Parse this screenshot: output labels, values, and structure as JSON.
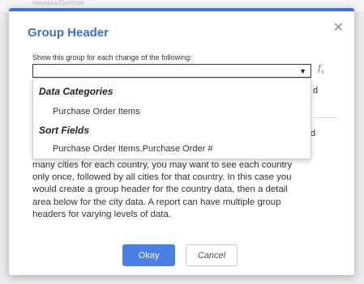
{
  "background": {
    "partial_text": "aaaaaaa/Durchaa"
  },
  "dialog": {
    "title": "Group Header",
    "close_icon": "close-icon",
    "field_label": "Show this group for each change of the following:",
    "select_value": "",
    "fx_label": "f",
    "fx_sub": "x",
    "obscured_text_1": "d",
    "obscured_text_2": "iled",
    "dropdown": {
      "groups": [
        {
          "label": "Data Categories",
          "options": [
            "Purchase Order Items"
          ]
        },
        {
          "label": "Sort Fields",
          "options": [
            "Purchase Order Items.Purchase Order #"
          ]
        }
      ]
    },
    "description_lines": [
      "many cities for each country, you may want to see each country",
      "only once, followed by all cities for that country. In this case you",
      "would create a group header for the country data, then a detail",
      "area below for the city data. A report can have multiple group",
      "headers for varying levels of data."
    ],
    "okay_label": "Okay",
    "cancel_label": "Cancel"
  },
  "colors": {
    "accent": "#3b73e0",
    "title": "#3b6fd4",
    "okay_bg": "#4a7fe6"
  }
}
